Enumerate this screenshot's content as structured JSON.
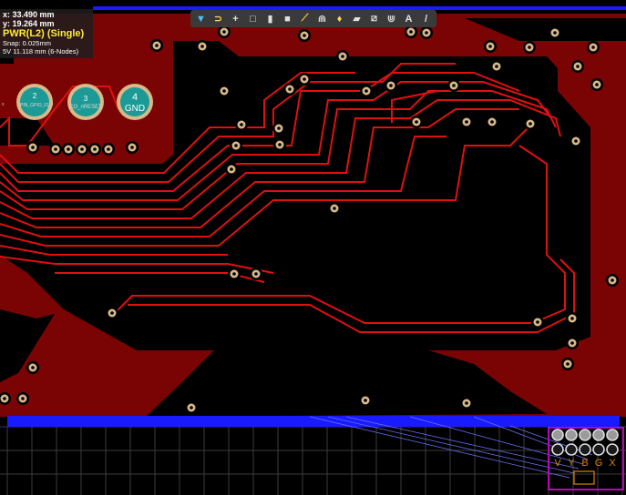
{
  "cursor": {
    "x_label": "x: 33.490 mm",
    "y_label": "y: 19.264  mm"
  },
  "layer_label": "PWR(L2) (Single)",
  "snap_label": "Snap: 0.025mm",
  "net_label": "5V   11.118 mm (6-Nodes)",
  "big_pads": [
    {
      "number": "2",
      "name": "PIN_GPIO_01"
    },
    {
      "number": "3",
      "name": "CO_nRESET"
    },
    {
      "number": "4",
      "name": "GND"
    }
  ],
  "small_labels": [
    "x",
    "x"
  ],
  "connector_labels": [
    "V",
    "Y",
    "B",
    "G",
    "X"
  ],
  "toolbar": [
    {
      "name": "filter-select-icon",
      "glyph": "▼"
    },
    {
      "name": "magnet-snap-icon",
      "glyph": "⊃"
    },
    {
      "name": "crosshair-icon",
      "glyph": "+"
    },
    {
      "name": "box-select-icon",
      "glyph": "□"
    },
    {
      "name": "bar-chart-icon",
      "glyph": "▮"
    },
    {
      "name": "square-fill-icon",
      "glyph": "■"
    },
    {
      "name": "route-wand-icon",
      "glyph": "⟋"
    },
    {
      "name": "measure-icon",
      "glyph": "⋒"
    },
    {
      "name": "highlight-net-icon",
      "glyph": "♦"
    },
    {
      "name": "layer-stack-icon",
      "glyph": "▰"
    },
    {
      "name": "slash-box-icon",
      "glyph": "⧄"
    },
    {
      "name": "comb-icon",
      "glyph": "⋓"
    },
    {
      "name": "text-tool-icon",
      "glyph": "A"
    },
    {
      "name": "line-tool-icon",
      "glyph": "/"
    }
  ],
  "colors": {
    "copper": "#7a0303",
    "trace": "#e01010",
    "board_edge": "#1a1aff",
    "via_ring": "#d7b98a",
    "pad_teal": "#1b9a96",
    "grid": "#3c3c3c",
    "outline": "#c000c0"
  }
}
